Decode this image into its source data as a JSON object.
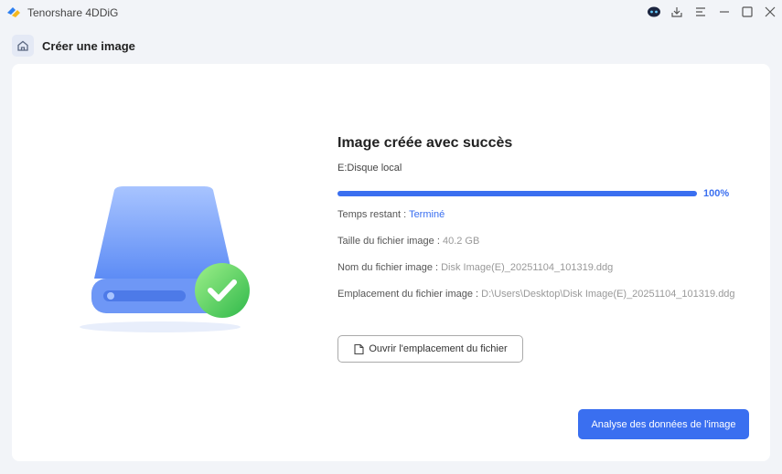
{
  "app": {
    "title": "Tenorshare 4DDiG"
  },
  "header": {
    "page_title": "Créer une image"
  },
  "main": {
    "title": "Image créée avec succès",
    "drive": "E:Disque local",
    "progress": {
      "value": 100,
      "label": "100%"
    },
    "rows": [
      {
        "label": "Temps restant : ",
        "value": "Terminé"
      },
      {
        "label": "Taille du fichier image : ",
        "value": "40.2 GB"
      },
      {
        "label": "Nom du fichier image : ",
        "value": "Disk Image(E)_20251104_101319.ddg"
      },
      {
        "label": "Emplacement du fichier image : ",
        "value": "D:\\Users\\Desktop\\Disk Image(E)_20251104_101319.ddg"
      }
    ],
    "open_location_label": "Ouvrir l'emplacement du fichier",
    "analyze_label": "Analyse des données de l'image"
  },
  "colors": {
    "accent": "#3a6ff0"
  }
}
